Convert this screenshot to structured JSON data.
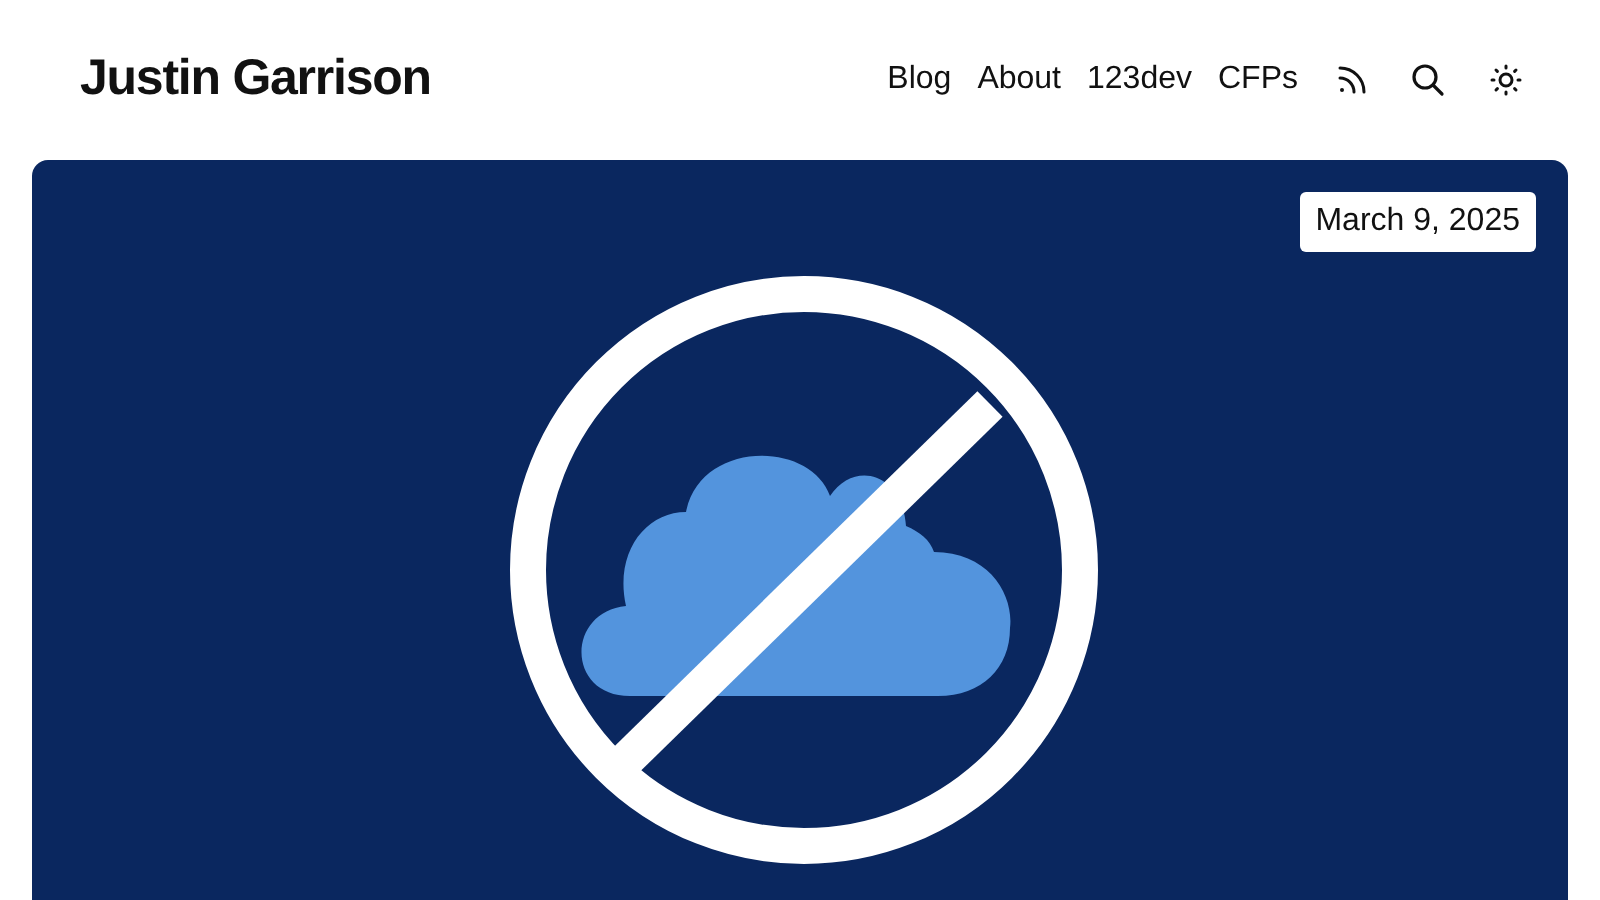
{
  "site_title": "Justin Garrison",
  "nav_links": [
    "Blog",
    "About",
    "123dev",
    "CFPs"
  ],
  "hero": {
    "date": "March 9, 2025"
  }
}
